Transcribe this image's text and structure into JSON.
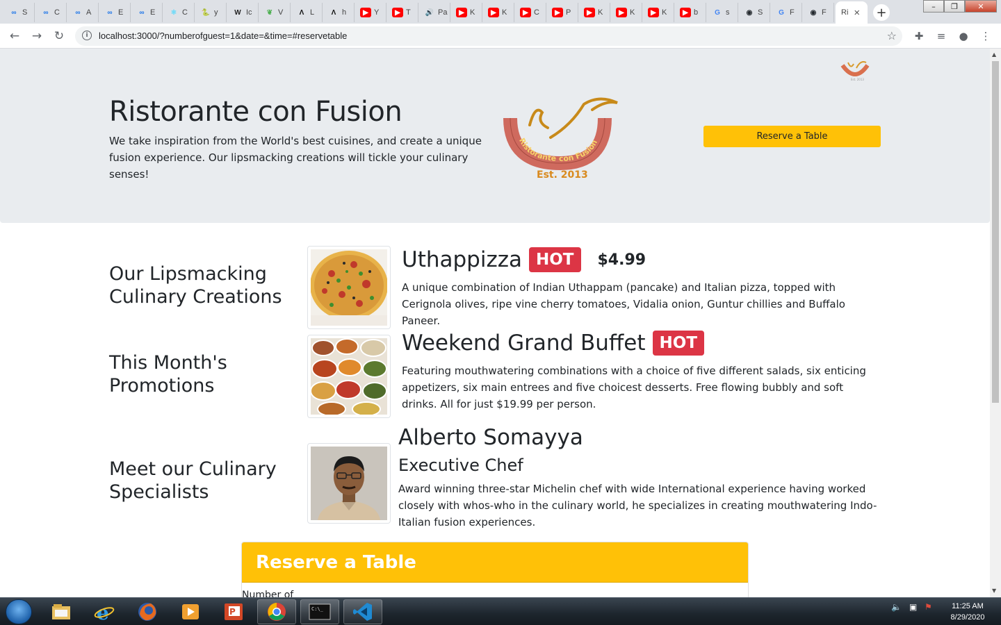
{
  "browser": {
    "tabs": [
      {
        "label": "S",
        "icon": "infinity-icon",
        "color": "#1a73e8"
      },
      {
        "label": "C",
        "icon": "infinity-icon",
        "color": "#1a73e8"
      },
      {
        "label": "A",
        "icon": "infinity-icon",
        "color": "#1a73e8"
      },
      {
        "label": "E",
        "icon": "infinity-icon",
        "color": "#1a73e8"
      },
      {
        "label": "E",
        "icon": "infinity-icon",
        "color": "#1a73e8"
      },
      {
        "label": "C",
        "icon": "react-icon",
        "color": "#61dafb"
      },
      {
        "label": "y",
        "icon": "mongoose-icon",
        "color": "#2a5db0"
      },
      {
        "label": "Ic",
        "icon": "wikipedia-icon",
        "color": "#222"
      },
      {
        "label": "V",
        "icon": "leaf-icon",
        "color": "#4caf50"
      },
      {
        "label": "L",
        "icon": "angular-icon",
        "color": "#111"
      },
      {
        "label": "h",
        "icon": "angular-icon",
        "color": "#111"
      },
      {
        "label": "Y",
        "icon": "youtube-icon",
        "color": "#ff0000"
      },
      {
        "label": "T",
        "icon": "youtube-icon",
        "color": "#ff0000"
      },
      {
        "label": "Pa",
        "icon": "speaker-icon",
        "color": "#888"
      },
      {
        "label": "K",
        "icon": "youtube-icon",
        "color": "#ff0000"
      },
      {
        "label": "K",
        "icon": "youtube-icon",
        "color": "#ff0000"
      },
      {
        "label": "C",
        "icon": "youtube-icon",
        "color": "#ff0000"
      },
      {
        "label": "P",
        "icon": "youtube-icon",
        "color": "#ff0000"
      },
      {
        "label": "K",
        "icon": "youtube-icon",
        "color": "#ff0000"
      },
      {
        "label": "K",
        "icon": "youtube-icon",
        "color": "#ff0000"
      },
      {
        "label": "K",
        "icon": "youtube-icon",
        "color": "#ff0000"
      },
      {
        "label": "b",
        "icon": "youtube-icon",
        "color": "#ff0000"
      },
      {
        "label": "s",
        "icon": "google-icon",
        "color": "#4285f4"
      },
      {
        "label": "S",
        "icon": "github-icon",
        "color": "#24292e"
      },
      {
        "label": "F",
        "icon": "google-icon",
        "color": "#4285f4"
      },
      {
        "label": "F",
        "icon": "github-icon",
        "color": "#24292e"
      }
    ],
    "active_tab": {
      "label": "Ri",
      "icon": "restaurant-icon"
    },
    "url": "localhost:3000/?numberofguest=1&date=&time=#reservetable"
  },
  "page": {
    "jumbotron": {
      "title": "Ristorante con Fusion",
      "description": "We take inspiration from the World's best cuisines, and create a unique fusion experience. Our lipsmacking creations will tickle your culinary senses!",
      "logo_text": "Ristorante con Fusion",
      "logo_est": "Est. 2013",
      "reserve_button": "Reserve a Table"
    },
    "sections": [
      {
        "heading": "Our Lipsmacking Culinary Creations",
        "title": "Uthappizza",
        "badge": "HOT",
        "price": "$4.99",
        "description": "A unique combination of Indian Uthappam (pancake) and Italian pizza, topped with Cerignola olives, ripe vine cherry tomatoes, Vidalia onion, Guntur chillies and Buffalo Paneer."
      },
      {
        "heading": "This Month's Promotions",
        "title": "Weekend Grand Buffet",
        "badge": "HOT",
        "description": "Featuring mouthwatering combinations with a choice of five different salads, six enticing appetizers, six main entrees and five choicest desserts. Free flowing bubbly and soft drinks. All for just $19.99 per person."
      },
      {
        "heading": "Meet our Culinary Specialists",
        "title": "Alberto Somayya",
        "subtitle": "Executive Chef",
        "description": "Award winning three-star Michelin chef with wide International experience having worked closely with whos-who in the culinary world, he specializes in creating mouthwatering Indo-Italian fusion experiences."
      }
    ],
    "reserve_card": {
      "header": "Reserve a Table",
      "first_label": "Number of"
    },
    "colors": {
      "accent": "#ffc107",
      "badge": "#dc3545",
      "jumbotron_bg": "#e9ecef"
    }
  },
  "taskbar": {
    "apps": [
      "explorer-icon",
      "internet-explorer-icon",
      "firefox-icon",
      "media-player-icon",
      "powerpoint-icon",
      "chrome-icon",
      "terminal-icon",
      "vscode-icon"
    ],
    "time": "11:25 AM",
    "date": "8/29/2020"
  }
}
